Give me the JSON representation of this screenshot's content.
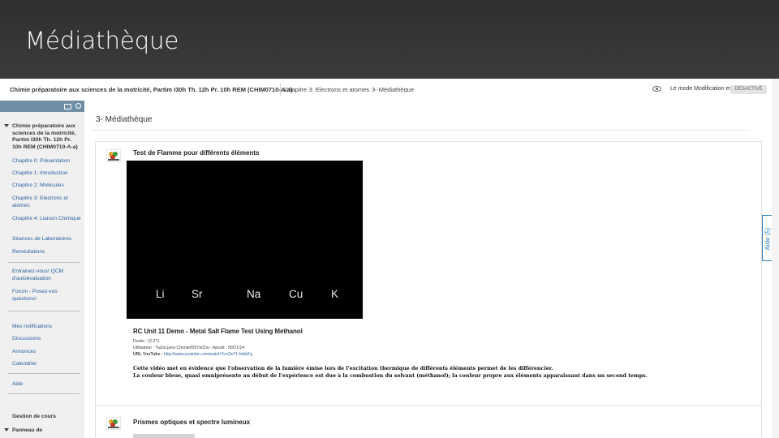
{
  "slide": {
    "title": "Médiathèque"
  },
  "topbar": {
    "course_link": "Chimie préparatoire aux sciences de la motricité, Partim I30h Th. 12h Pr. 10h REM (CHIM0710-A-a)",
    "breadcrumb": [
      "Chapitre 3: Electrons et atomes",
      "3- Médiathèque"
    ],
    "breadcrumb_sep": "›",
    "edit_mode_label": "Le mode Modification est :",
    "edit_mode_state": "DÉSACTIVÉ"
  },
  "sidebar": {
    "course_heading": "Chimie préparatoire aux sciences de la motricité, Partim I30h Th. 12h Pr. 10h REM (CHIM0710-A-a)",
    "items": [
      "Chapitre 0: Présentation",
      "Chapitre 1: Introduction",
      "Chapitre 2: Molécules",
      "Chapitre 3: Electrons et atomes",
      "Chapitre 4: Liaison Chimique",
      "Séances de Laboratoires",
      "Remédiations",
      "Entrainez-vous! QCM d'autoévaluation",
      "Forum - Posez-vos questions!",
      "Mes notifications",
      "Discussions",
      "Annonces",
      "Calendrier",
      "Aide"
    ],
    "sections": [
      "Gestion de cours",
      "Panneau de"
    ]
  },
  "main": {
    "page_title": "3- Médiathèque",
    "item1": {
      "title": "Test de Flamme pour différents éléments",
      "video_labels": [
        "Li",
        "Sr",
        "Na",
        "Cu",
        "K"
      ],
      "video_title": "RC Unit 11 Demo - Metal Salt Flame Test Using Methanol",
      "duration": "Durée : (2:27)",
      "uploader": "Utilisateur : TaiJuLjany-Chimie0007a01w - Ajouté : 09/21/14",
      "url_label": "URL YouTube :",
      "url": "http://www.youtube.com/watch?v=ZaY1-htdqYg",
      "desc_line1": "Cette vidéo met en évidence que l'observation de la lumière émise lors de l'excitation thermique de différents éléments permet de les différencier.",
      "desc_line2": "La couleur bleue, quasi omniprésente au début de l'expérience est due à la combustion du solvant (méthanol); la couleur propre aux éléments apparaissant dans un second temps."
    },
    "item2": {
      "title": "Prismes optiques et spectre lumineux"
    }
  },
  "help_tab": {
    "label": "Aide (5)"
  },
  "colors": {
    "accent": "#2b7ec1",
    "sidebar_bar": "#6f8fa6",
    "link": "#2a5fa0"
  }
}
